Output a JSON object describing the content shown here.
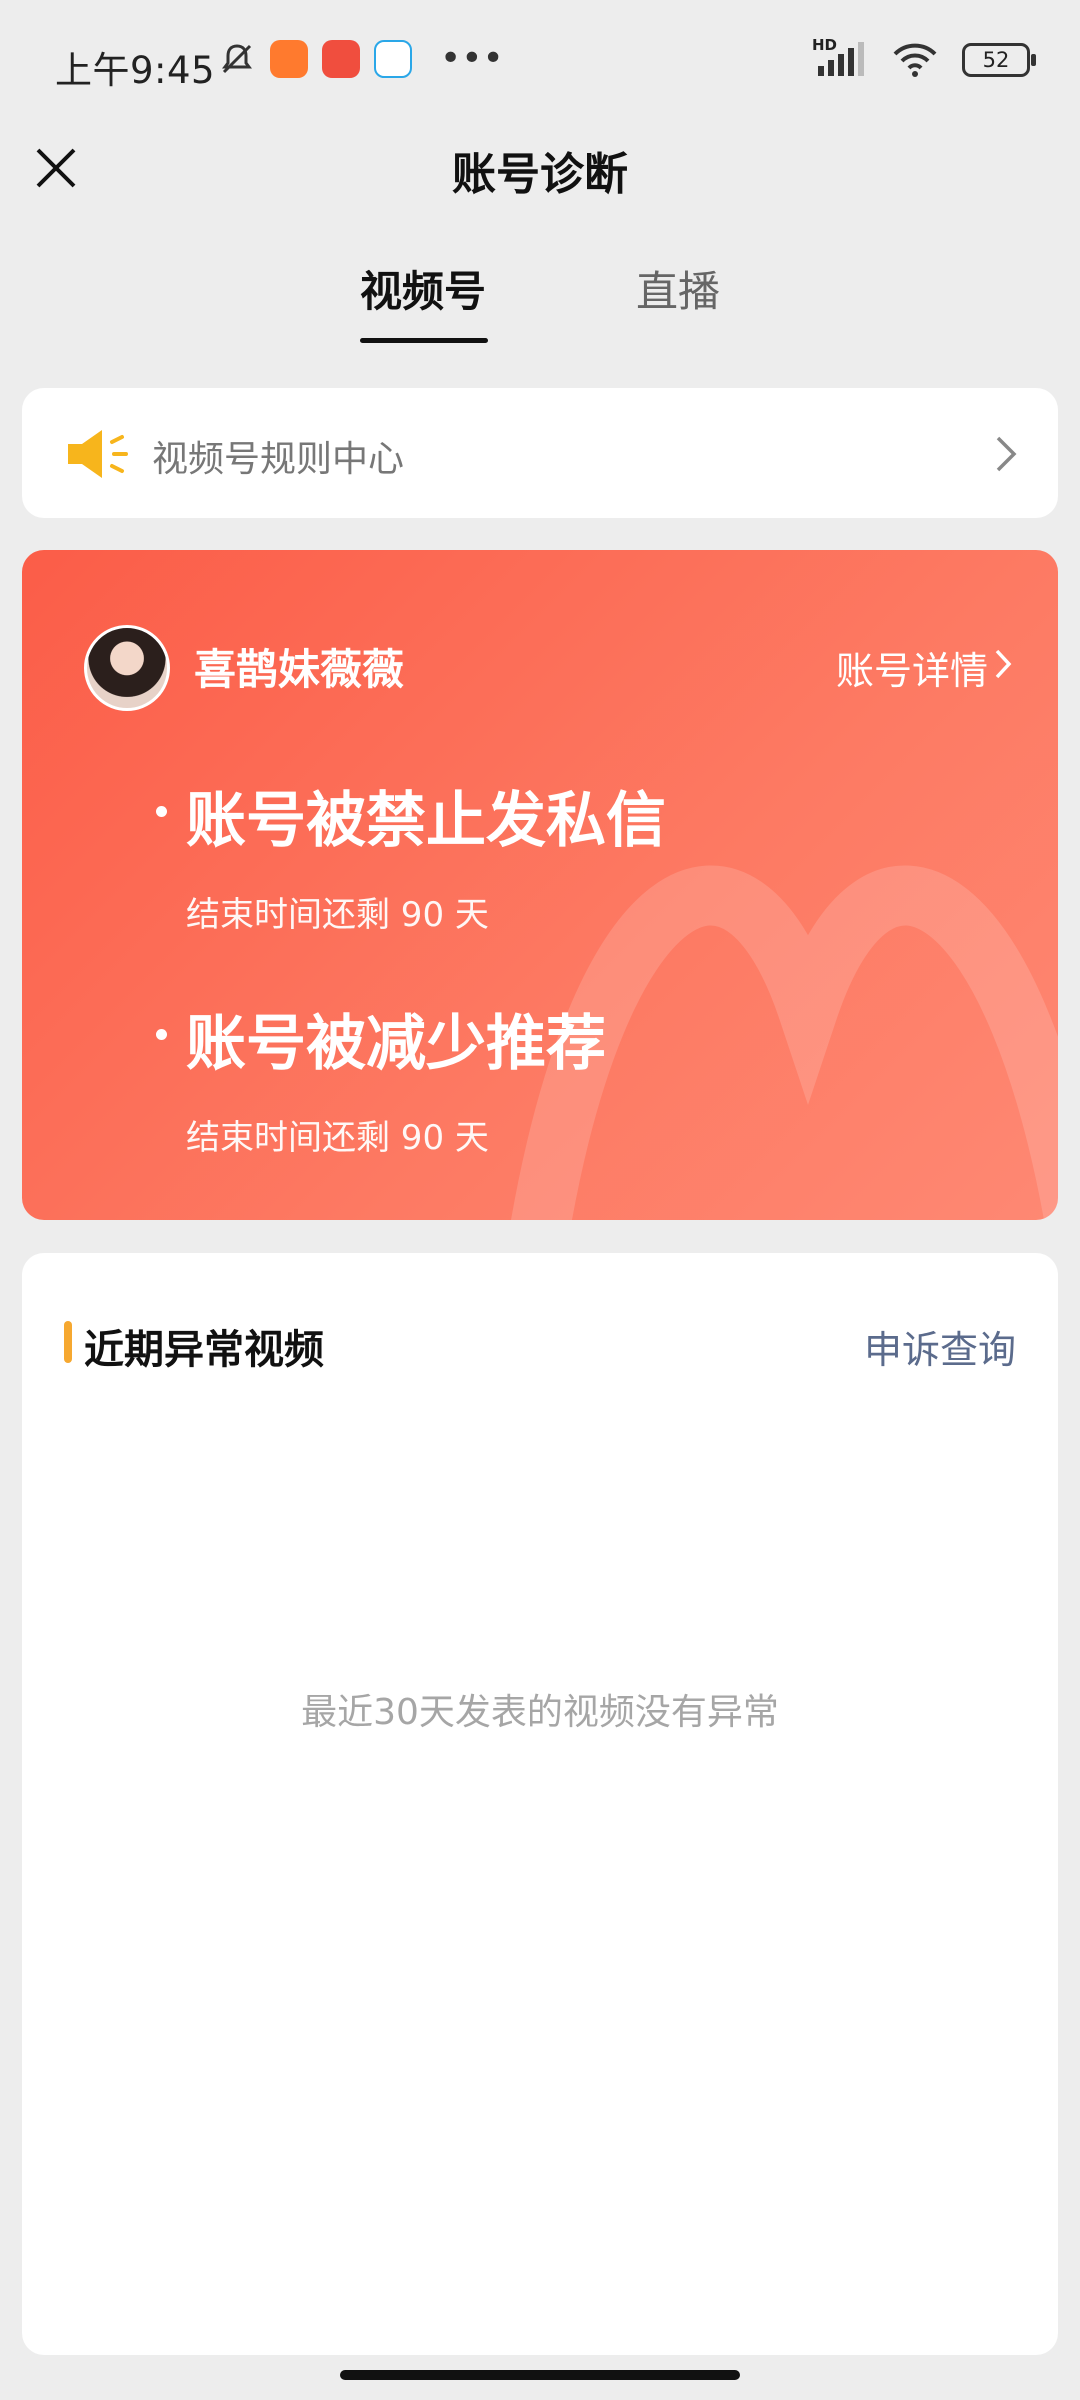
{
  "status_bar": {
    "time": "上午9:45",
    "network": "HD",
    "battery": "52"
  },
  "nav": {
    "title": "账号诊断"
  },
  "tabs": [
    {
      "label": "视频号",
      "active": true
    },
    {
      "label": "直播",
      "active": false
    }
  ],
  "rules": {
    "label": "视频号规则中心"
  },
  "account": {
    "name": "喜鹊妹薇薇",
    "detail_link": "账号详情",
    "restrictions": [
      {
        "title": "账号被禁止发私信",
        "remaining": "结束时间还剩 90 天"
      },
      {
        "title": "账号被减少推荐",
        "remaining": "结束时间还剩 90 天"
      }
    ]
  },
  "videos": {
    "title": "近期异常视频",
    "appeal_link": "申诉查询",
    "empty_message": "最近30天发表的视频没有异常"
  },
  "colors": {
    "accent": "#f6a830",
    "card_red": "#fb5d48",
    "link": "#5b6b8c"
  }
}
